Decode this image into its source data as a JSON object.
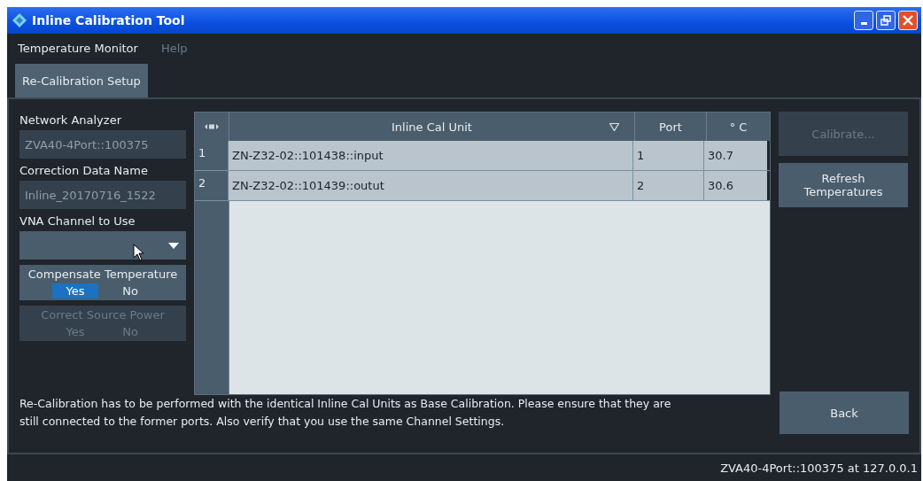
{
  "window": {
    "title": "Inline Calibration Tool"
  },
  "menu": [
    {
      "label": "Temperature Monitor",
      "disabled": false
    },
    {
      "label": "Help",
      "disabled": true
    }
  ],
  "tabs": [
    {
      "label": "Re-Calibration Setup",
      "selected": true
    }
  ],
  "fields": [
    {
      "label": "Network Analyzer",
      "value": "ZVA40-4Port::100375",
      "kind": "text"
    },
    {
      "label": "Correction Data Name",
      "value": "Inline_20170716_1522",
      "kind": "text"
    },
    {
      "label": "VNA Channel to Use",
      "kind": "dropdown"
    }
  ],
  "toggles": [
    {
      "label": "Compensate Temperature",
      "disabled": false,
      "options": [
        {
          "label": "Yes",
          "selected": true
        },
        {
          "label": "No",
          "selected": false
        }
      ]
    },
    {
      "label": "Correct Source Power",
      "disabled": true,
      "options": [
        {
          "label": "Yes",
          "selected": false
        },
        {
          "label": "No",
          "selected": false
        }
      ]
    }
  ],
  "table": {
    "columns": [
      "Inline Cal Unit",
      "Port",
      "° C"
    ],
    "rows": [
      {
        "index": "1",
        "cells": [
          "ZN-Z32-02::101438::input",
          "1",
          "30.7"
        ]
      },
      {
        "index": "2",
        "cells": [
          "ZN-Z32-02::101439::outut",
          "2",
          "30.6"
        ]
      }
    ]
  },
  "buttons": [
    {
      "label": "Calibrate...",
      "disabled": true
    },
    {
      "label": "Refresh Temperatures",
      "disabled": false
    }
  ],
  "message": "Re-Calibration has to be performed with the identical Inline Cal Units as Base Calibration. Please ensure that they are still connected to the former ports. Also verify that you use the same Channel Settings.",
  "back_button": {
    "label": "Back"
  },
  "status_bar": "ZVA40-4Port::100375 at 127.0.0.1"
}
